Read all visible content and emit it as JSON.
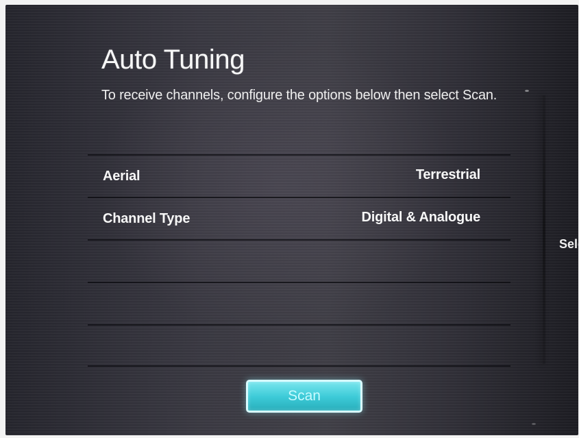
{
  "screen": {
    "title": "Auto Tuning",
    "description": "To receive channels, configure the options below then select Scan.",
    "settings": [
      {
        "label": "Aerial",
        "value": "Terrestrial"
      },
      {
        "label": "Channel Type",
        "value": "Digital & Analogue"
      }
    ],
    "scan_button_label": "Scan",
    "right_side_text": "Sele"
  }
}
